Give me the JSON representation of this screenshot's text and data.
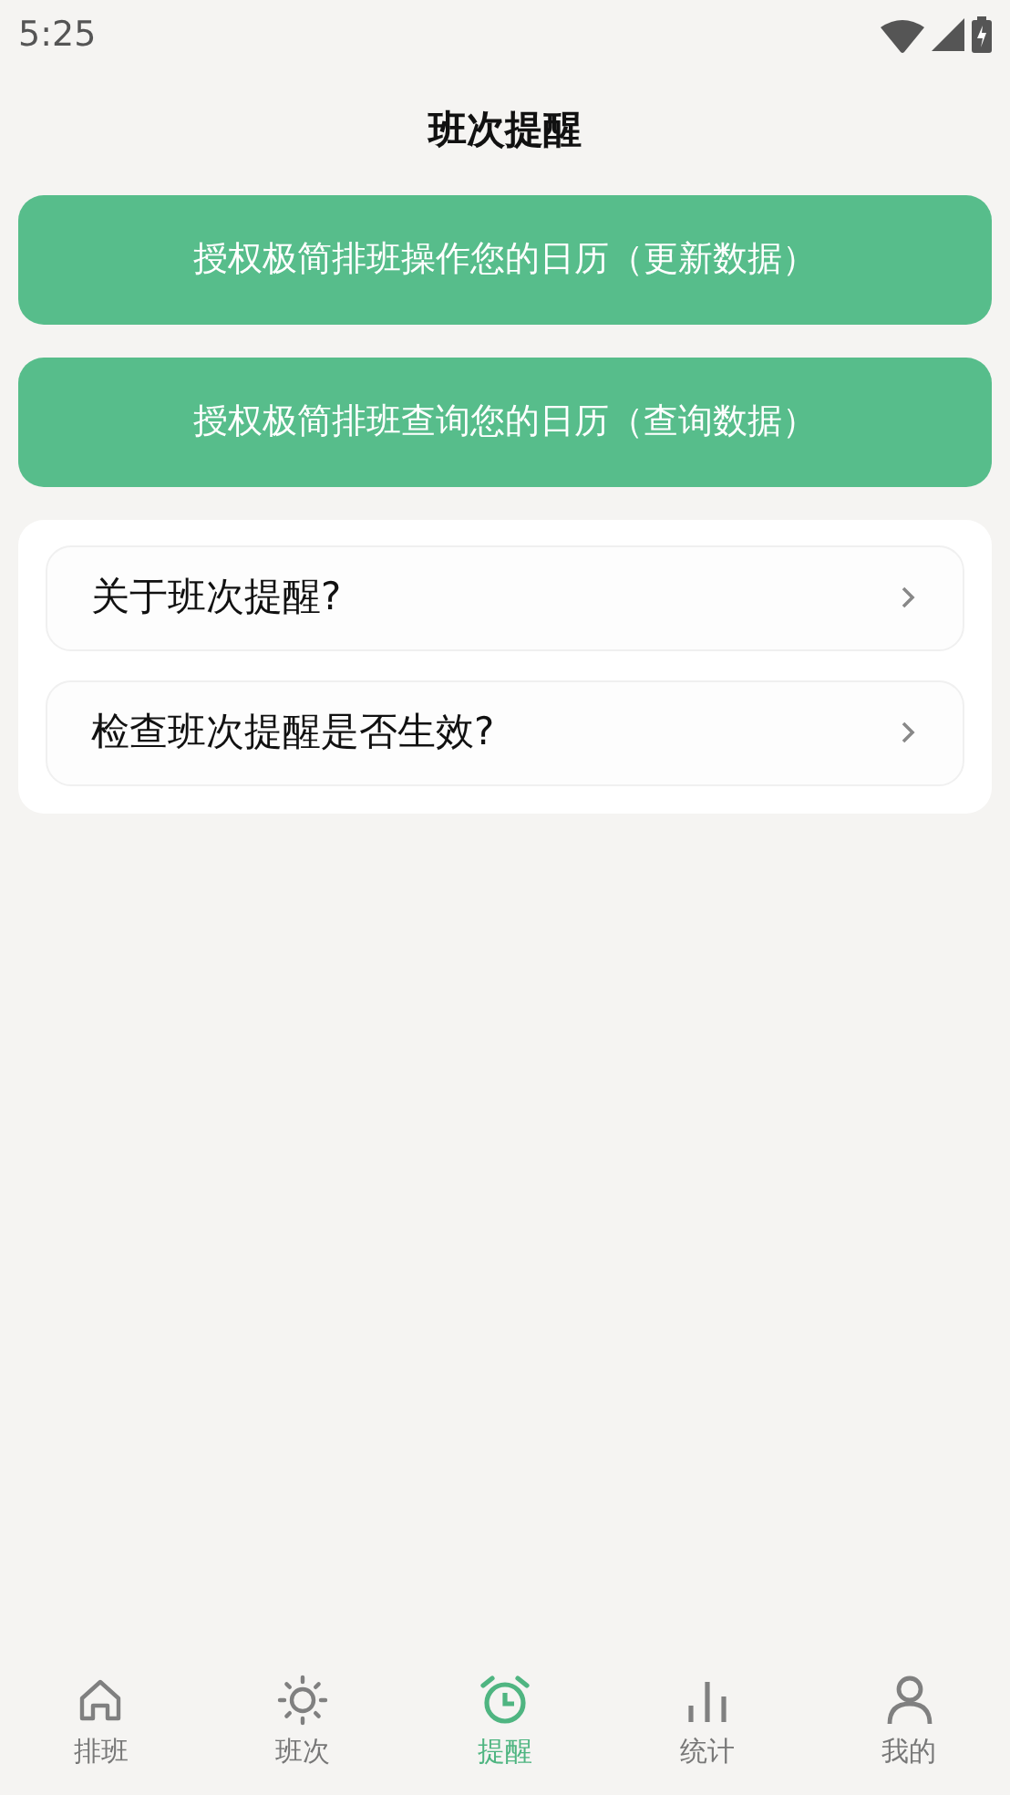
{
  "status_bar": {
    "time": "5:25"
  },
  "title": "班次提醒",
  "action_buttons": [
    "授权极简排班操作您的日历（更新数据）",
    "授权极简排班查询您的日历（查询数据）"
  ],
  "menu_items": [
    {
      "label": "关于班次提醒?"
    },
    {
      "label": "检查班次提醒是否生效?"
    }
  ],
  "tabs": [
    {
      "label": "排班",
      "selected": false
    },
    {
      "label": "班次",
      "selected": false
    },
    {
      "label": "提醒",
      "selected": true
    },
    {
      "label": "统计",
      "selected": false
    },
    {
      "label": "我的",
      "selected": false
    }
  ]
}
